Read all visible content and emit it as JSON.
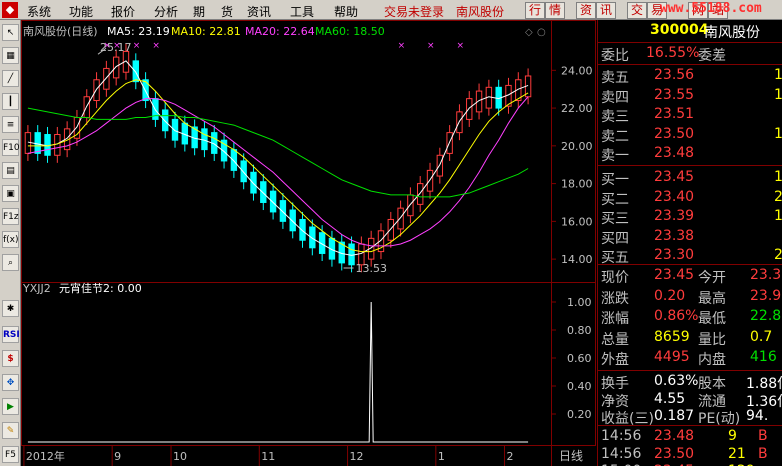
{
  "menu": {
    "items": [
      "系统",
      "功能",
      "报价",
      "分析",
      "期",
      "货",
      "资讯",
      "工具",
      "帮助"
    ],
    "trade_status": "交易未登录",
    "stock_link": "南风股份",
    "buttons": [
      "行",
      "情",
      "资",
      "讯",
      "交",
      "易",
      "网",
      "站"
    ],
    "watermark": "www.55188.com"
  },
  "left_toolbar": [
    "",
    "",
    "",
    "",
    "",
    "F10",
    "",
    "",
    "F1z",
    "f(x)",
    "",
    "",
    "RSI",
    "$",
    "",
    "",
    "",
    "F5"
  ],
  "chart": {
    "header": {
      "name": "南风股份(日线)",
      "ma5": "MA5: 23.19",
      "ma10": "MA10: 22.81",
      "ma20": "MA20: 22.64",
      "ma60": "MA60: 18.50"
    },
    "colors": {
      "ma5": "#ffffff",
      "ma10": "#ffff00",
      "ma20": "#ff40ff",
      "ma60": "#00e000",
      "up": "#ff3c3c",
      "down": "#00ffff",
      "grid": "#800000"
    },
    "high_label": "25.17",
    "low_label": "13.53",
    "y_ticks": [
      "24.00",
      "22.00",
      "20.00",
      "18.00",
      "16.00",
      "14.00"
    ],
    "indicator_title": "YXJJ2",
    "indicator_value": "元宵佳节2: 0.00",
    "indicator_ticks": [
      "1.00",
      "0.80",
      "0.60",
      "0.40",
      "0.20"
    ],
    "x_labels": [
      "2012年",
      "9",
      "10",
      "11",
      "12",
      "1",
      "2"
    ],
    "period_label": "日线"
  },
  "chart_data": {
    "type": "line",
    "title": "南风股份(日线)",
    "xlabel": "",
    "ylabel": "",
    "ylim": [
      13,
      25.5
    ],
    "x_axis_labels": [
      "2012年",
      "9",
      "10",
      "11",
      "12",
      "1",
      "2"
    ],
    "series": [
      {
        "name": "MA5",
        "color": "#ffffff",
        "values": [
          20.2,
          20.1,
          20.0,
          20.1,
          20.4,
          21.0,
          22.1,
          23.0,
          23.6,
          24.2,
          24.5,
          23.9,
          22.9,
          21.9,
          21.3,
          20.8,
          20.6,
          20.4,
          20.3,
          20.1,
          19.7,
          19.2,
          18.6,
          18.0,
          17.5,
          17.0,
          16.5,
          16.0,
          15.5,
          15.1,
          14.8,
          14.5,
          14.3,
          14.2,
          14.3,
          14.6,
          15.0,
          15.6,
          16.2,
          16.9,
          17.5,
          18.2,
          19.0,
          20.2,
          21.3,
          22.0,
          22.4,
          22.6,
          22.5,
          22.7,
          23.0,
          23.2
        ]
      },
      {
        "name": "MA10",
        "color": "#ffff00",
        "values": [
          20.0,
          20.0,
          20.0,
          20.1,
          20.3,
          20.6,
          21.2,
          21.8,
          22.4,
          22.9,
          23.3,
          23.5,
          23.4,
          22.9,
          22.3,
          21.7,
          21.2,
          20.9,
          20.6,
          20.4,
          20.1,
          19.8,
          19.4,
          18.9,
          18.4,
          17.9,
          17.4,
          16.9,
          16.4,
          15.9,
          15.5,
          15.1,
          14.8,
          14.5,
          14.4,
          14.4,
          14.6,
          14.9,
          15.3,
          15.8,
          16.3,
          16.9,
          17.5,
          18.2,
          19.0,
          19.8,
          20.6,
          21.3,
          21.8,
          22.2,
          22.5,
          22.8
        ]
      },
      {
        "name": "MA20",
        "color": "#ff40ff",
        "values": [
          19.6,
          19.7,
          19.8,
          19.9,
          20.0,
          20.2,
          20.5,
          20.8,
          21.2,
          21.6,
          22.0,
          22.3,
          22.5,
          22.5,
          22.4,
          22.2,
          21.9,
          21.6,
          21.3,
          21.0,
          20.6,
          20.2,
          19.8,
          19.4,
          19.0,
          18.6,
          18.1,
          17.6,
          17.1,
          16.6,
          16.1,
          15.7,
          15.3,
          15.0,
          14.8,
          14.7,
          14.7,
          14.7,
          14.8,
          15.0,
          15.3,
          15.6,
          16.0,
          16.5,
          17.1,
          17.8,
          18.6,
          19.5,
          20.3,
          21.2,
          22.0,
          22.6
        ]
      },
      {
        "name": "MA60",
        "color": "#00e000",
        "values": [
          22.0,
          21.9,
          21.8,
          21.7,
          21.6,
          21.5,
          21.5,
          21.4,
          21.4,
          21.4,
          21.4,
          21.5,
          21.5,
          21.6,
          21.6,
          21.6,
          21.5,
          21.5,
          21.4,
          21.3,
          21.2,
          21.1,
          20.9,
          20.7,
          20.5,
          20.3,
          20.0,
          19.7,
          19.4,
          19.1,
          18.8,
          18.5,
          18.2,
          18.0,
          17.8,
          17.6,
          17.5,
          17.4,
          17.4,
          17.4,
          17.3,
          17.3,
          17.3,
          17.3,
          17.4,
          17.5,
          17.7,
          17.9,
          18.1,
          18.3,
          18.5,
          18.8
        ]
      }
    ],
    "indicator": {
      "name": "元宵佳节2",
      "spike_index": 35,
      "spike_value": 1.0,
      "ylim": [
        0,
        1.1
      ]
    }
  },
  "quote": {
    "code": "300004",
    "name": "南风股份",
    "rows_top": [
      {
        "label": "委比",
        "value": "16.55%",
        "label2": "委差"
      }
    ],
    "asks": [
      {
        "label": "卖五",
        "price": "23.56",
        "vol": "1"
      },
      {
        "label": "卖四",
        "price": "23.55",
        "vol": "1"
      },
      {
        "label": "卖三",
        "price": "23.51",
        "vol": ""
      },
      {
        "label": "卖二",
        "price": "23.50",
        "vol": "1"
      },
      {
        "label": "卖一",
        "price": "23.48",
        "vol": ""
      }
    ],
    "bids": [
      {
        "label": "买一",
        "price": "23.45",
        "vol": "1"
      },
      {
        "label": "买二",
        "price": "23.40",
        "vol": "2"
      },
      {
        "label": "买三",
        "price": "23.39",
        "vol": "1"
      },
      {
        "label": "买四",
        "price": "23.38",
        "vol": ""
      },
      {
        "label": "买五",
        "price": "23.30",
        "vol": "2"
      }
    ],
    "stats": [
      {
        "l1": "现价",
        "v1": "23.45",
        "c1": "red",
        "l2": "今开",
        "v2": "23.3",
        "c2": "red"
      },
      {
        "l1": "涨跌",
        "v1": "0.20",
        "c1": "red",
        "l2": "最高",
        "v2": "23.9",
        "c2": "red"
      },
      {
        "l1": "涨幅",
        "v1": "0.86%",
        "c1": "red",
        "l2": "最低",
        "v2": "22.8",
        "c2": "green"
      },
      {
        "l1": "总量",
        "v1": "8659",
        "c1": "yellow",
        "l2": "量比",
        "v2": "0.7",
        "c2": "yellow"
      },
      {
        "l1": "外盘",
        "v1": "4495",
        "c1": "red",
        "l2": "内盘",
        "v2": "416",
        "c2": "green"
      }
    ],
    "stats2": [
      {
        "l1": "换手",
        "v1": "0.63%",
        "l2": "股本",
        "v2": "1.88亿"
      },
      {
        "l1": "净资",
        "v1": "4.55",
        "l2": "流通",
        "v2": "1.36亿"
      },
      {
        "l1": "收益(三)",
        "v1": "0.187",
        "l2": "PE(动)",
        "v2": "94."
      }
    ],
    "ticks": [
      {
        "time": "14:56",
        "price": "23.48",
        "vol": "9",
        "side": "B"
      },
      {
        "time": "14:56",
        "price": "23.50",
        "vol": "21",
        "side": "B"
      },
      {
        "time": "15:00",
        "price": "23.45",
        "vol": "129",
        "side": ""
      }
    ]
  }
}
